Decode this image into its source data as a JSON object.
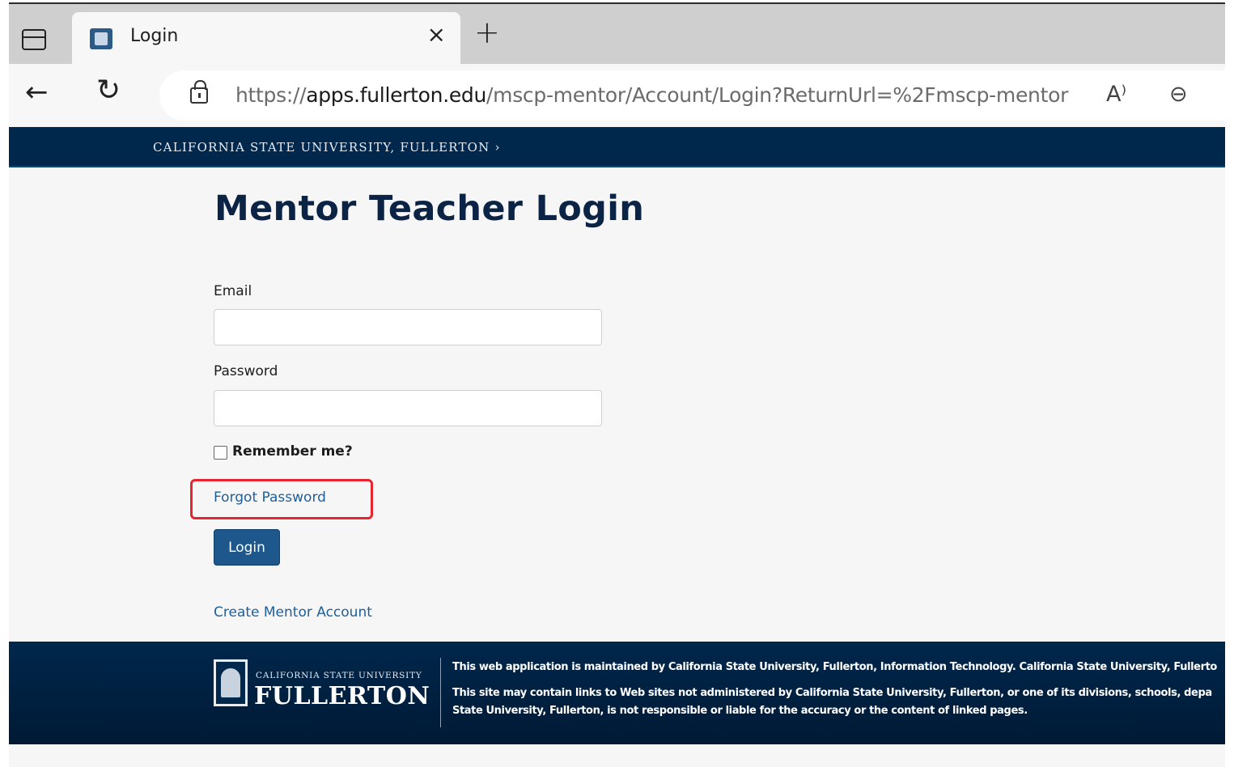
{
  "browser": {
    "tab_title": "Login",
    "tab_close_glyph": "×",
    "new_tab_glyph": "+",
    "back_glyph": "←",
    "reload_glyph": "↻",
    "url_scheme": "https://",
    "url_host": "apps.fullerton.edu",
    "url_path": "/mscp-mentor/Account/Login?ReturnUrl=%2Fmscp-mentor",
    "read_aloud_glyph": "A⁾",
    "zoom_glyph": "⊖"
  },
  "banner": {
    "university_link": "CALIFORNIA STATE UNIVERSITY, FULLERTON ›"
  },
  "login": {
    "title": "Mentor Teacher Login",
    "email_label": "Email",
    "email_value": "",
    "password_label": "Password",
    "password_value": "",
    "remember_label": "Remember me?",
    "forgot_link": "Forgot Password",
    "login_button": "Login",
    "create_link": "Create Mentor Account"
  },
  "footer": {
    "logo_top": "CALIFORNIA STATE UNIVERSITY",
    "logo_main": "FULLERTON",
    "line1": "This web application is maintained by California State University, Fullerton, Information Technology. California State University, Fullerto",
    "line2": "This site may contain links to Web sites not administered by California State University, Fullerton, or one of its divisions, schools, depa",
    "line3": "State University, Fullerton, is not responsible or liable for the accuracy or the content of linked pages."
  },
  "colors": {
    "brand_navy": "#00274c",
    "link_blue": "#1f5f99",
    "button_blue": "#1d578b",
    "highlight_red": "#e8242e"
  }
}
